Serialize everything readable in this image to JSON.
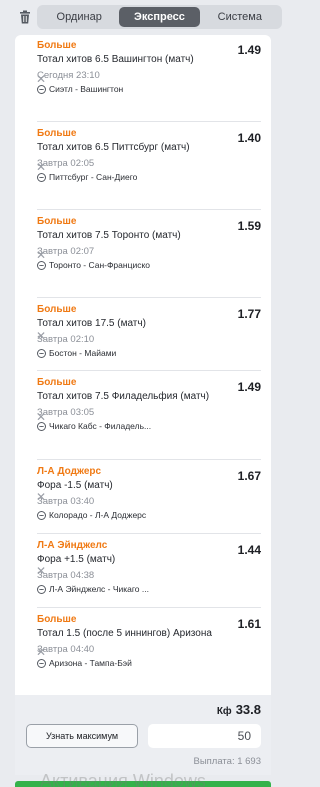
{
  "tabs": [
    "Ординар",
    "Экспресс",
    "Система"
  ],
  "active_tab": "Экспресс",
  "bets": [
    {
      "pick": "Больше",
      "market": "Тотал хитов 6.5 Вашингтон (матч)",
      "time": "Сегодня 23:10",
      "event": "Сиэтл - Вашингтон",
      "odds": "1.49"
    },
    {
      "pick": "Больше",
      "market": "Тотал хитов 6.5 Питтсбург (матч)",
      "time": "Завтра 02:05",
      "event": "Питтсбург - Сан-Диего",
      "odds": "1.40"
    },
    {
      "pick": "Больше",
      "market": "Тотал хитов 7.5 Торонто (матч)",
      "time": "Завтра 02:07",
      "event": "Торонто - Сан-Франциско",
      "odds": "1.59"
    },
    {
      "pick": "Больше",
      "market": "Тотал хитов 17.5 (матч)",
      "time": "Завтра 02:10",
      "event": "Бостон - Майами",
      "odds": "1.77"
    },
    {
      "pick": "Больше",
      "market": "Тотал хитов 7.5 Филадельфия (матч)",
      "time": "Завтра 03:05",
      "event": "Чикаго Кабс - Филадель...",
      "odds": "1.49"
    },
    {
      "pick": "Л-А Доджерс",
      "market": "Фора -1.5 (матч)",
      "time": "Завтра 03:40",
      "event": "Колорадо - Л-А Доджерс",
      "odds": "1.67"
    },
    {
      "pick": "Л-А Эйнджелс",
      "market": "Фора +1.5 (матч)",
      "time": "Завтра 04:38",
      "event": "Л-А Эйнджелс - Чикаго ...",
      "odds": "1.44"
    },
    {
      "pick": "Больше",
      "market": "Тотал 1.5 (после 5 иннингов) Аризона",
      "time": "Завтра 04:40",
      "event": "Аризона - Тампа-Бэй",
      "odds": "1.61"
    }
  ],
  "footer": {
    "kf_label": "Кф",
    "kf_value": "33.8",
    "max_button": "Узнать максимум",
    "stake_value": "50",
    "payout": "Выплата: 1 693"
  },
  "watermark": "Активация Windows",
  "colors": {
    "pick": "#f07a14",
    "active_tab": "#5b5f66",
    "green_bar": "#34b24a"
  },
  "icons": {
    "delete_all": "trash-icon",
    "remove_bet": "close-icon",
    "sport": "baseball-icon"
  }
}
